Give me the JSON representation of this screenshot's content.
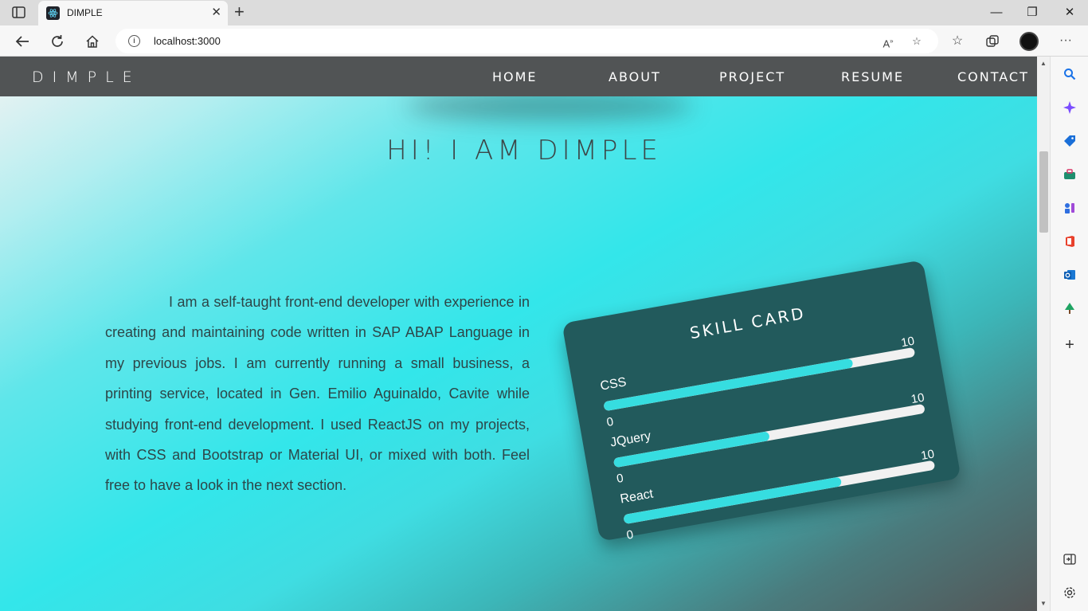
{
  "browser": {
    "tab_title": "DIMPLE",
    "url": "localhost:3000"
  },
  "site": {
    "brand": "DIMPLE",
    "nav": [
      {
        "label": "HOME"
      },
      {
        "label": "ABOUT"
      },
      {
        "label": "PROJECT"
      },
      {
        "label": "RESUME"
      },
      {
        "label": "CONTACT"
      }
    ],
    "hero_title": "HI! I AM DIMPLE",
    "about_text": "I am a self-taught front-end developer with experience in creating and maintaining code written in SAP ABAP Language in my previous jobs. I am currently running a small business, a printing service, located in Gen. Emilio Aguinaldo, Cavite while studying front-end development. I used ReactJS on my projects, with CSS and Bootstrap or Material UI, or mixed with both. Feel free to have a look in the next section.",
    "skill_card": {
      "title": "SKILL CARD",
      "skills": [
        {
          "name": "CSS",
          "value": 8,
          "min": "0",
          "max": "10"
        },
        {
          "name": "JQuery",
          "value": 5,
          "min": "0",
          "max": "10"
        },
        {
          "name": "React",
          "value": 7,
          "min": "0",
          "max": "10"
        }
      ]
    }
  },
  "colors": {
    "nav_bg": "#515455",
    "card_bg": "#225a5c",
    "accent": "#36dde0"
  }
}
